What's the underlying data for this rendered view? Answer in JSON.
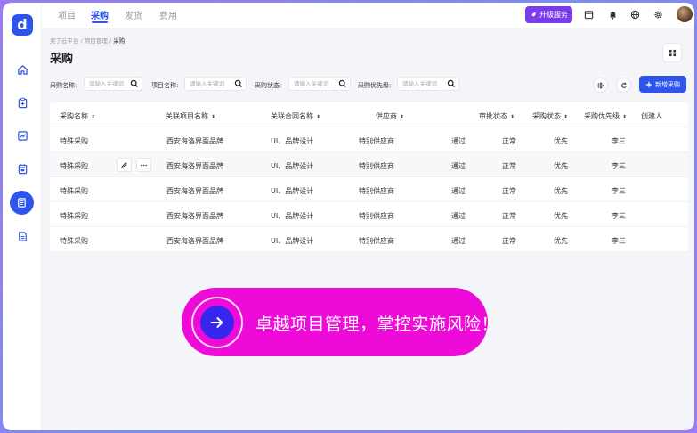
{
  "sidebar": {
    "logo_text": "d",
    "items": [
      {
        "icon": "home-icon"
      },
      {
        "icon": "clipboard-icon"
      },
      {
        "icon": "chart-icon"
      },
      {
        "icon": "calendar-icon"
      },
      {
        "icon": "list-document-icon",
        "active": true
      },
      {
        "icon": "document-icon"
      }
    ]
  },
  "topbar": {
    "tabs": [
      "项目",
      "采购",
      "发货",
      "费用"
    ],
    "active_tab": "采购",
    "upgrade_label": "升级服务",
    "icons": [
      "calendar-icon",
      "bell-icon",
      "globe-icon",
      "settings-icon",
      "avatar"
    ]
  },
  "breadcrumb": {
    "items": [
      "奥丁云平台",
      "项目管理"
    ],
    "current": "采购",
    "separator": " / "
  },
  "page": {
    "title": "采购"
  },
  "filters": [
    {
      "label": "采购名称:",
      "placeholder": "请输入关键词"
    },
    {
      "label": "项目名称:",
      "placeholder": "请输入关键词"
    },
    {
      "label": "采购状态:",
      "placeholder": "请输入关键词"
    },
    {
      "label": "采购优先级:",
      "placeholder": "请输入关键词"
    }
  ],
  "toolbar": {
    "new_label": "新增采购",
    "icons": [
      "column-settings-icon",
      "refresh-icon",
      "plus-icon"
    ]
  },
  "table": {
    "columns": [
      "采购名称",
      "关联项目名称",
      "关联合同名称",
      "供应商",
      "审批状态",
      "采购状态",
      "采购优先级",
      "创建人"
    ],
    "rows": [
      [
        "特殊采购",
        "西安海洛界面品牌",
        "UI、品牌设计",
        "特别供应商",
        "通过",
        "正常",
        "优先",
        "李三"
      ],
      [
        "特殊采购",
        "西安海洛界面品牌",
        "UI、品牌设计",
        "特别供应商",
        "通过",
        "正常",
        "优先",
        "李三"
      ],
      [
        "特殊采购",
        "西安海洛界面品牌",
        "UI、品牌设计",
        "特别供应商",
        "通过",
        "正常",
        "优先",
        "李三"
      ],
      [
        "特殊采购",
        "西安海洛界面品牌",
        "UI、品牌设计",
        "特别供应商",
        "通过",
        "正常",
        "优先",
        "李三"
      ],
      [
        "特殊采购",
        "西安海洛界面品牌",
        "UI、品牌设计",
        "特别供应商",
        "通过",
        "正常",
        "优先",
        "李三"
      ]
    ],
    "row_action_icons": [
      "edit-icon",
      "more-icon"
    ],
    "sort_glyph": "⬍"
  },
  "banner": {
    "text": "卓越项目管理，掌控实施风险！"
  },
  "colors": {
    "primary": "#2f54eb",
    "upgrade": "#7c3aed",
    "banner_bg": "#ee0bda",
    "banner_arrow": "#3626ee"
  }
}
